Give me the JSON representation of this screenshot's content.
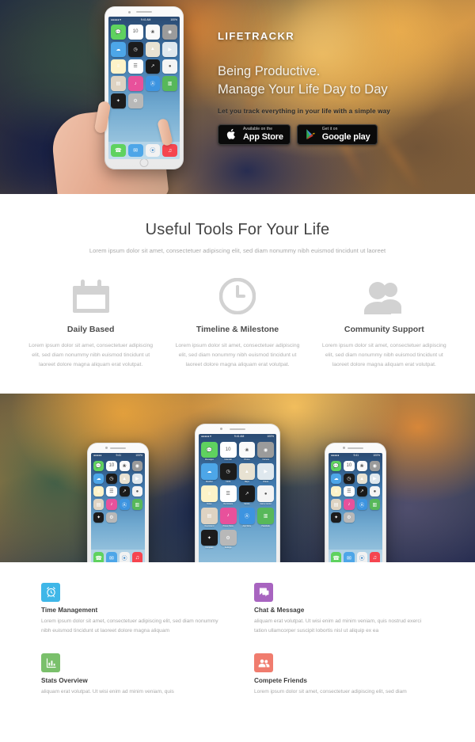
{
  "hero": {
    "brand": "LIFETRACKR",
    "headline_line1": "Being Productive.",
    "headline_line2": "Manage Your Life Day to Day",
    "subtitle": "Let you track everything in your life with a simple way",
    "badges": [
      {
        "small": "Available on the",
        "large": "App Store",
        "icon": "apple-icon"
      },
      {
        "small": "Get it on",
        "large": "Google play",
        "icon": "google-play-icon"
      }
    ]
  },
  "tools": {
    "title": "Useful Tools For Your Life",
    "lede": "Lorem ipsum dolor sit amet, consectetuer adipiscing elit, sed diam nonummy nibh euismod tincidunt ut laoreet",
    "items": [
      {
        "icon": "calendar-icon",
        "title": "Daily Based",
        "text": "Lorem ipsum dolor sit amet, consectetuer adipiscing elit, sed diam nonummy nibh euismod tincidunt ut laoreet dolore magna aliquam erat volutpat."
      },
      {
        "icon": "clock-icon",
        "title": "Timeline & Milestone",
        "text": "Lorem ipsum dolor sit amet, consectetuer adipiscing elit, sed diam nonummy nibh euismod tincidunt ut laoreet dolore magna aliquam erat volutpat."
      },
      {
        "icon": "users-icon",
        "title": "Community Support",
        "text": "Lorem ipsum dolor sit amet, consectetuer adipiscing elit, sed diam nonummy nibh euismod tincidunt ut laoreet dolore magna aliquam erat volutpat."
      }
    ]
  },
  "phone_screen": {
    "status_left": "●●●●● ▾",
    "status_center": "9:41 AM",
    "status_right": "100%",
    "apps": [
      {
        "name": "Messages",
        "color": "#5fd25f",
        "glyph": "💬"
      },
      {
        "name": "Calendar",
        "color": "#ffffff",
        "glyph": "10"
      },
      {
        "name": "Photos",
        "color": "#fafafa",
        "glyph": "❀"
      },
      {
        "name": "Camera",
        "color": "#9b9b9b",
        "glyph": "◉"
      },
      {
        "name": "Weather",
        "color": "#4da6e8",
        "glyph": "☁"
      },
      {
        "name": "Clock",
        "color": "#1c1c1c",
        "glyph": "◷"
      },
      {
        "name": "Maps",
        "color": "#e8e2d2",
        "glyph": "▲"
      },
      {
        "name": "Videos",
        "color": "#dfe8ee",
        "glyph": "▶"
      },
      {
        "name": "Notes",
        "color": "#fdf3c8",
        "glyph": "≡"
      },
      {
        "name": "Reminders",
        "color": "#ffffff",
        "glyph": "☰"
      },
      {
        "name": "Stocks",
        "color": "#1a1a1a",
        "glyph": "↗"
      },
      {
        "name": "Game Center",
        "color": "#f4f4f4",
        "glyph": "●"
      },
      {
        "name": "Newsstand",
        "color": "#ded3c2",
        "glyph": "▤"
      },
      {
        "name": "iTunes Store",
        "color": "#e8519b",
        "glyph": "♪"
      },
      {
        "name": "App Store",
        "color": "#3d94e0",
        "glyph": "Ⓐ"
      },
      {
        "name": "Passbook",
        "color": "#57b85a",
        "glyph": "▥"
      },
      {
        "name": "Compass",
        "color": "#1c1c1c",
        "glyph": "✦"
      },
      {
        "name": "Settings",
        "color": "#b8b8b8",
        "glyph": "⚙"
      }
    ],
    "dock": [
      {
        "name": "Phone",
        "color": "#5fd25f",
        "glyph": "☎"
      },
      {
        "name": "Mail",
        "color": "#4da6e8",
        "glyph": "✉"
      },
      {
        "name": "Safari",
        "color": "#f2f2f2",
        "glyph": "⦿"
      },
      {
        "name": "Music",
        "color": "#f5454f",
        "glyph": "♫"
      }
    ]
  },
  "features": [
    {
      "icon": "alarm-clock-icon",
      "color": "#3fb7e8",
      "title": "Time Management",
      "text": "Lorem ipsum dolor sit amet, consectetuer adipiscing elit, sed diam nonummy nibh euismod tincidunt ut laoreet dolore magna aliquam"
    },
    {
      "icon": "chat-bubble-icon",
      "color": "#a864c0",
      "title": "Chat & Message",
      "text": "aliquam erat volutpat. Ut wisi enim ad minim veniam, quis nostrud exerci tation ullamcorper suscipit lobortis nisl ut aliquip ex ea"
    },
    {
      "icon": "bar-chart-icon",
      "color": "#7ac06b",
      "title": "Stats Overview",
      "text": "aliquam erat volutpat. Ut wisi enim ad minim veniam, quis"
    },
    {
      "icon": "people-icon",
      "color": "#f07c6e",
      "title": "Compete Friends",
      "text": "Lorem ipsum dolor sit amet, consectetuer adipiscing elit, sed diam"
    }
  ]
}
